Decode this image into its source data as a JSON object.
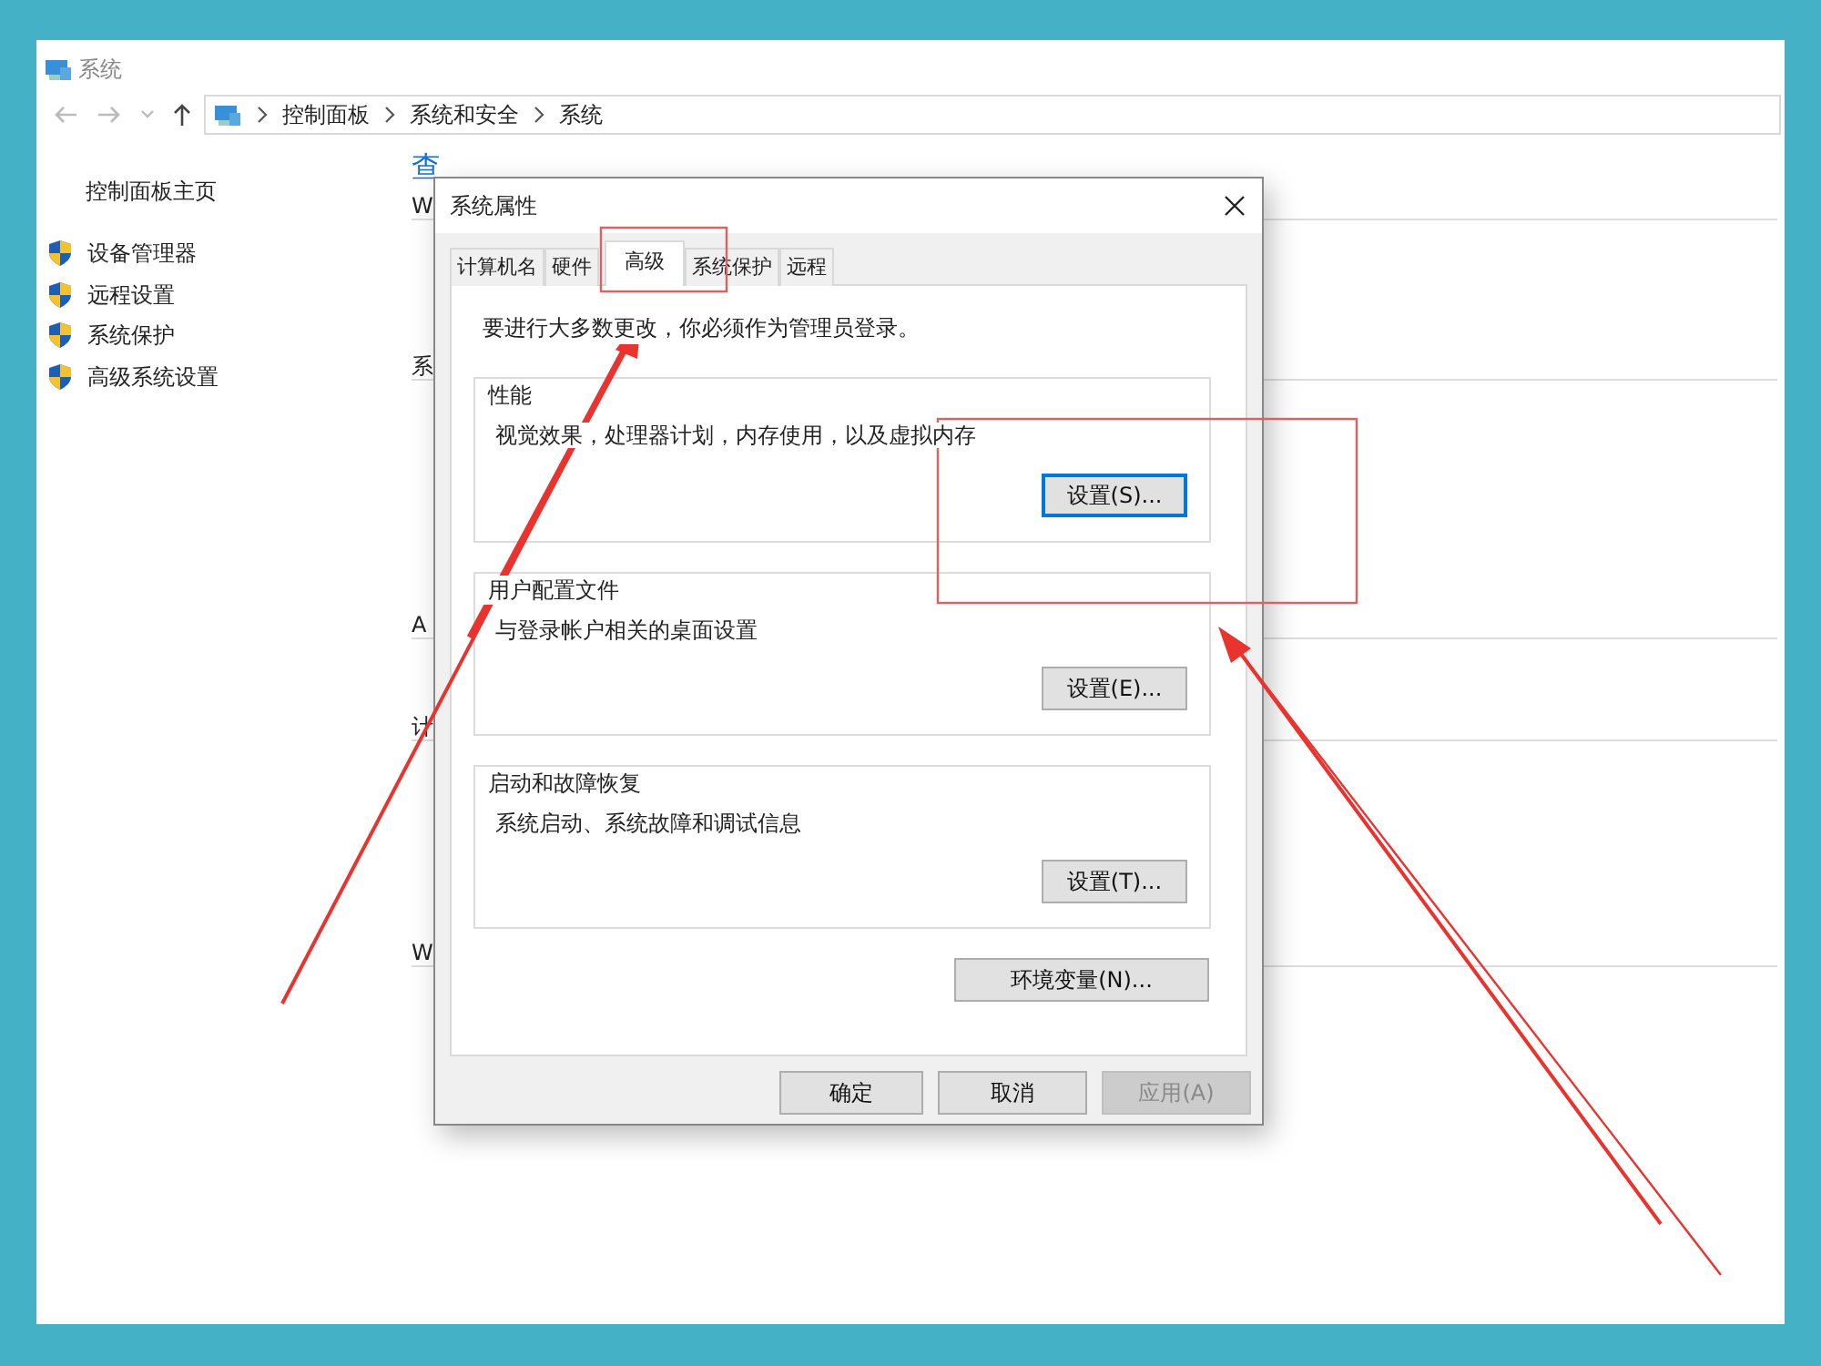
{
  "window": {
    "title": "系统"
  },
  "address_bar": {
    "breadcrumb": [
      "控制面板",
      "系统和安全",
      "系统"
    ]
  },
  "sidebar": {
    "home_link": "控制面板主页",
    "items": [
      {
        "label": "设备管理器"
      },
      {
        "label": "远程设置"
      },
      {
        "label": "系统保护"
      },
      {
        "label": "高级系统设置"
      }
    ]
  },
  "content_fragments": [
    {
      "text": "查",
      "kind": "link"
    },
    {
      "text": "W",
      "kind": "text"
    },
    {
      "text": "系",
      "kind": "text"
    },
    {
      "text": "A",
      "kind": "text"
    },
    {
      "text": "计",
      "kind": "text"
    },
    {
      "text": "W",
      "kind": "text"
    }
  ],
  "dialog": {
    "title": "系统属性",
    "tabs": [
      {
        "label": "计算机名",
        "selected": false
      },
      {
        "label": "硬件",
        "selected": false
      },
      {
        "label": "高级",
        "selected": true
      },
      {
        "label": "系统保护",
        "selected": false
      },
      {
        "label": "远程",
        "selected": false
      }
    ],
    "notice": "要进行大多数更改，你必须作为管理员登录。",
    "groups": [
      {
        "title": "性能",
        "description": "视觉效果，处理器计划，内存使用，以及虚拟内存",
        "button": {
          "label": "设置(S)...",
          "focused": true
        }
      },
      {
        "title": "用户配置文件",
        "description": "与登录帐户相关的桌面设置",
        "button": {
          "label": "设置(E)...",
          "focused": false
        }
      },
      {
        "title": "启动和故障恢复",
        "description": "系统启动、系统故障和调试信息",
        "button": {
          "label": "设置(T)...",
          "focused": false
        }
      }
    ],
    "env_button": {
      "label": "环境变量(N)..."
    },
    "footer_buttons": [
      {
        "label": "确定",
        "disabled": false
      },
      {
        "label": "取消",
        "disabled": false
      },
      {
        "label": "应用(A)",
        "disabled": true
      }
    ]
  }
}
